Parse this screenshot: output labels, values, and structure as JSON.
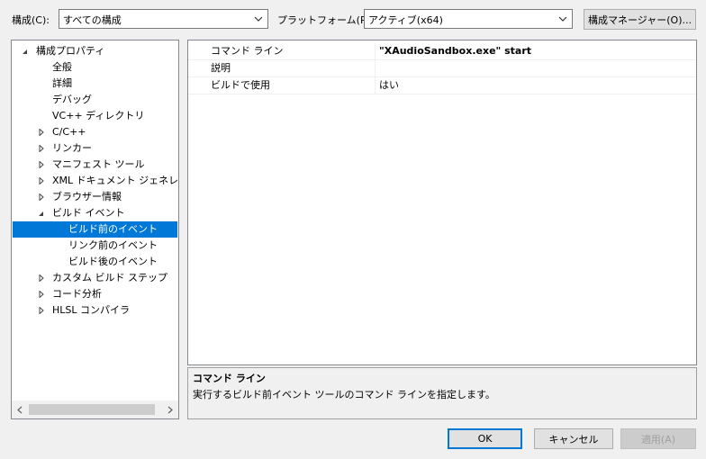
{
  "toolbar": {
    "config_label": "構成(C):",
    "config_value": "すべての構成",
    "platform_label": "プラットフォーム(P):",
    "platform_value": "アクティブ(x64)",
    "config_manager_label": "構成マネージャー(O)..."
  },
  "tree": {
    "items": [
      {
        "label": "構成プロパティ",
        "expander": "expanded"
      },
      {
        "label": "全般",
        "expander": "none"
      },
      {
        "label": "詳細",
        "expander": "none"
      },
      {
        "label": "デバッグ",
        "expander": "none"
      },
      {
        "label": "VC++ ディレクトリ",
        "expander": "none"
      },
      {
        "label": "C/C++",
        "expander": "collapsed"
      },
      {
        "label": "リンカー",
        "expander": "collapsed"
      },
      {
        "label": "マニフェスト ツール",
        "expander": "collapsed"
      },
      {
        "label": "XML ドキュメント ジェネレーター",
        "expander": "collapsed"
      },
      {
        "label": "ブラウザー情報",
        "expander": "collapsed"
      },
      {
        "label": "ビルド イベント",
        "expander": "expanded"
      },
      {
        "label": "ビルド前のイベント",
        "expander": "none",
        "selected": true
      },
      {
        "label": "リンク前のイベント",
        "expander": "none"
      },
      {
        "label": "ビルド後のイベント",
        "expander": "none"
      },
      {
        "label": "カスタム ビルド ステップ",
        "expander": "collapsed"
      },
      {
        "label": "コード分析",
        "expander": "collapsed"
      },
      {
        "label": "HLSL コンパイラ",
        "expander": "collapsed"
      }
    ]
  },
  "properties": [
    {
      "name": "コマンド ライン",
      "value": "\"XAudioSandbox.exe\" start",
      "bold": true
    },
    {
      "name": "説明",
      "value": ""
    },
    {
      "name": "ビルドで使用",
      "value": "はい"
    }
  ],
  "description": {
    "title": "コマンド ライン",
    "body": "実行するビルド前イベント ツールのコマンド ラインを指定します。"
  },
  "buttons": {
    "ok": "OK",
    "cancel": "キャンセル",
    "apply": "適用(A)"
  },
  "colors": {
    "selection": "#0078d7",
    "window_bg": "#f0f0f0"
  }
}
